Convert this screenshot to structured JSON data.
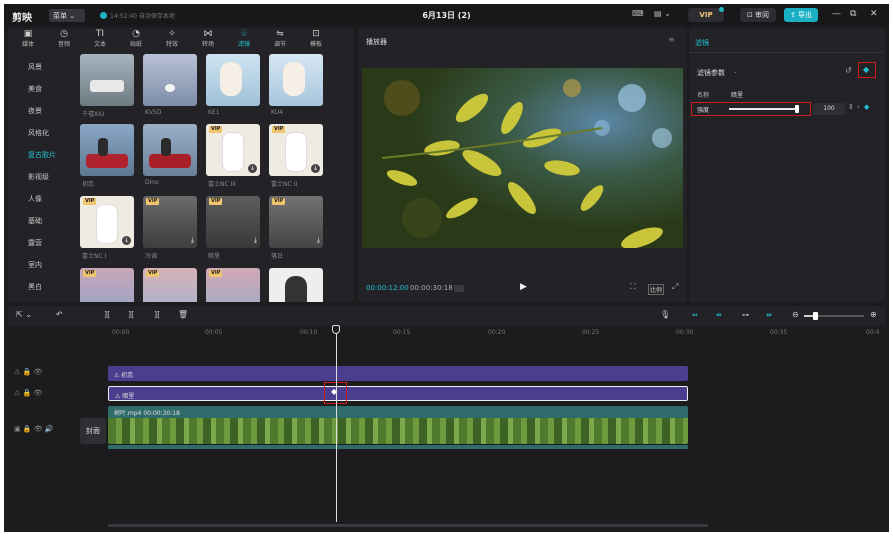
{
  "titlebar": {
    "logo": "剪映",
    "menu": "菜单 ⌄",
    "autosave": "14:52:40 自动保存本地",
    "project": "6月13日 (2)",
    "vip": "VIP",
    "review": "审阅",
    "export": "导出",
    "minimize": "—",
    "maximize": "⧉",
    "close": "✕"
  },
  "tabs": [
    {
      "icon": "▣",
      "label": "媒体"
    },
    {
      "icon": "◷",
      "label": "音频"
    },
    {
      "icon": "TI",
      "label": "文本"
    },
    {
      "icon": "◔",
      "label": "贴纸"
    },
    {
      "icon": "✧",
      "label": "特效"
    },
    {
      "icon": "⋈",
      "label": "转场"
    },
    {
      "icon": "♧",
      "label": "滤镜"
    },
    {
      "icon": "⇋",
      "label": "调节"
    },
    {
      "icon": "⊡",
      "label": "模板"
    }
  ],
  "categories": [
    "风景",
    "美食",
    "夜景",
    "风格化",
    "复古胶片",
    "影视级",
    "人像",
    "基础",
    "露营",
    "室内",
    "黑白"
  ],
  "filters": [
    {
      "label": "千禧XIU"
    },
    {
      "label": "KV5D"
    },
    {
      "label": "KE1"
    },
    {
      "label": "KU4"
    },
    {
      "label": "初恋"
    },
    {
      "label": "Dino"
    },
    {
      "label": "富士NC III"
    },
    {
      "label": "富士NC II"
    },
    {
      "label": "富士NC I"
    },
    {
      "label": "冷调"
    },
    {
      "label": "暗里"
    },
    {
      "label": "落日"
    },
    {
      "label": ""
    },
    {
      "label": ""
    },
    {
      "label": ""
    },
    {
      "label": ""
    }
  ],
  "vip_badge": "VIP",
  "player": {
    "title": "播放器",
    "current": "00:00:12:00",
    "total": "00:00:30:18",
    "ratio": "比例"
  },
  "right_panel": {
    "title": "滤镜",
    "section": "滤镜参数",
    "name_label": "名称",
    "name_value": "暗里",
    "intensity_label": "强度",
    "intensity_value": "100",
    "intensity_fraction": 1.0
  },
  "ruler": [
    "00:00",
    "00:05",
    "00:10",
    "00:15",
    "00:20",
    "00:25",
    "00:30",
    "00:35",
    "00:4"
  ],
  "tracks": {
    "filter1": "初恋",
    "filter2": "暗里",
    "video_name": "树叶.mp4",
    "video_duration": "00:00:30:18",
    "cover": "封面"
  },
  "colors": {
    "accent": "#21c2d4",
    "clip_purple": "#4b3e8f",
    "clip_teal": "#2f6b6b",
    "red_highlight": "#d11a1a"
  }
}
